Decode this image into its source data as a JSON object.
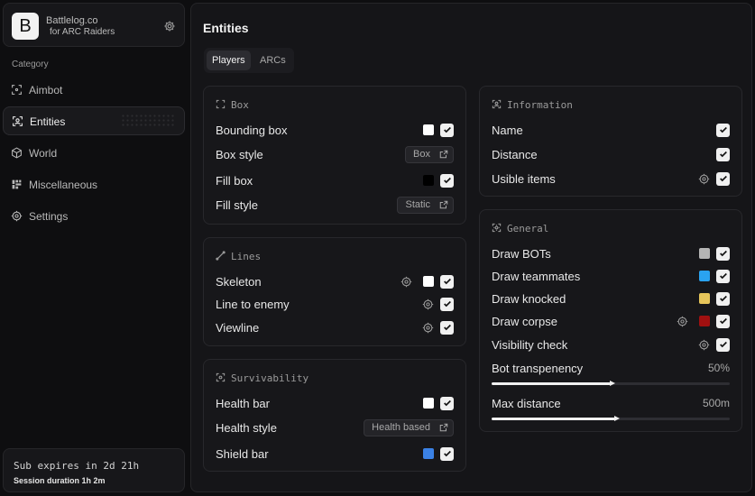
{
  "brand": {
    "logo_letter": "B",
    "name": "Battlelog.co",
    "subtitle": "for ARC Raiders"
  },
  "sidebar": {
    "category_title": "Category",
    "items": [
      {
        "label": "Aimbot",
        "icon": "aimbot-icon",
        "active": false
      },
      {
        "label": "Entities",
        "icon": "entities-icon",
        "active": true
      },
      {
        "label": "World",
        "icon": "world-icon",
        "active": false
      },
      {
        "label": "Miscellaneous",
        "icon": "misc-icon",
        "active": false
      },
      {
        "label": "Settings",
        "icon": "settings-icon",
        "active": false
      }
    ]
  },
  "subscription": {
    "expires": "Sub expires in 2d 21h",
    "session": "Session duration 1h  2m"
  },
  "main": {
    "title": "Entities",
    "tabs": [
      {
        "label": "Players",
        "active": true
      },
      {
        "label": "ARCs",
        "active": false
      }
    ]
  },
  "cards": {
    "box": {
      "title": "Box",
      "rows": {
        "bounding_box": {
          "label": "Bounding box",
          "color": "#ffffff"
        },
        "box_style": {
          "label": "Box style",
          "value": "Box"
        },
        "fill_box": {
          "label": "Fill box",
          "color": "#000000"
        },
        "fill_style": {
          "label": "Fill style",
          "value": "Static"
        }
      }
    },
    "lines": {
      "title": "Lines",
      "rows": {
        "skeleton": {
          "label": "Skeleton",
          "color": "#ffffff"
        },
        "line_to_enemy": {
          "label": "Line to enemy"
        },
        "viewline": {
          "label": "Viewline"
        }
      }
    },
    "survivability": {
      "title": "Survivability",
      "rows": {
        "health_bar": {
          "label": "Health bar",
          "color": "#ffffff"
        },
        "health_style": {
          "label": "Health style",
          "value": "Health based"
        },
        "shield_bar": {
          "label": "Shield bar",
          "color": "#3b82e6"
        }
      }
    },
    "information": {
      "title": "Information",
      "rows": {
        "name": {
          "label": "Name"
        },
        "distance": {
          "label": "Distance"
        },
        "visible_items": {
          "label": "Usible items"
        }
      }
    },
    "general": {
      "title": "General",
      "rows": {
        "draw_bots": {
          "label": "Draw BOTs",
          "color": "#b5b5b5"
        },
        "draw_teammates": {
          "label": "Draw teammates",
          "color": "#2aa3f0"
        },
        "draw_knocked": {
          "label": "Draw knocked",
          "color": "#e6c55a"
        },
        "draw_corpse": {
          "label": "Draw corpse",
          "color": "#a01010"
        },
        "visibility_check": {
          "label": "Visibility check"
        }
      },
      "sliders": {
        "bot_transparency": {
          "label": "Bot transpenency",
          "value_text": "50%",
          "fraction": 0.5
        },
        "max_distance": {
          "label": "Max distance",
          "value_text": "500m",
          "fraction": 0.52
        }
      }
    }
  }
}
